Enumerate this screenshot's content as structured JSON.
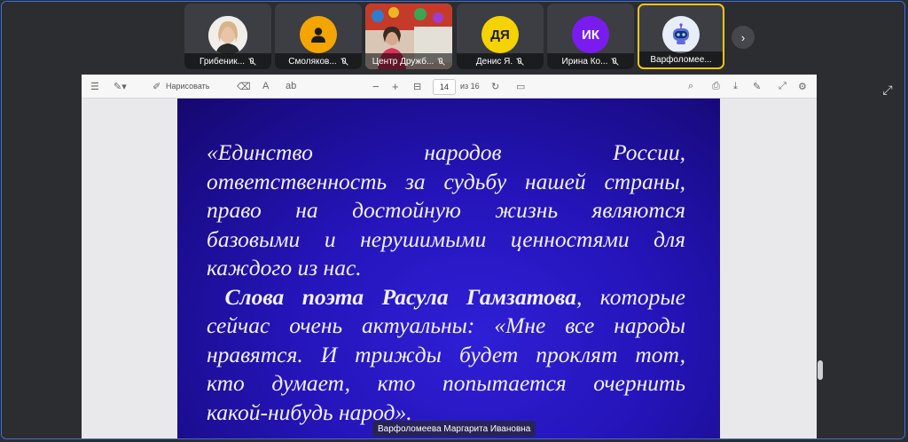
{
  "participants": [
    {
      "name": "Грибеник...",
      "type": "photo",
      "avatar_color": "#e7e2dc"
    },
    {
      "name": "Смоляков...",
      "type": "icon",
      "avatar_color": "#f5a500",
      "icon": "person-icon"
    },
    {
      "name": "Центр Дружб...",
      "type": "photo",
      "avatar_color": "#c7623e"
    },
    {
      "name": "Денис Я.",
      "type": "initials",
      "initials": "ДЯ",
      "avatar_color": "#f5d300"
    },
    {
      "name": "Ирина Ко...",
      "type": "initials",
      "initials": "ИК",
      "avatar_color": "#7a1cf0"
    },
    {
      "name": "Варфоломее...",
      "type": "bot",
      "avatar_color": "#e8eef8",
      "active": true
    }
  ],
  "toolbar": {
    "draw_label": "Нарисовать",
    "zoom_minus": "−",
    "zoom_plus": "+",
    "page_current": "14",
    "page_total": "из 16"
  },
  "slide": {
    "line1": "«Единство народов России,",
    "line2": "ответственность за судьбу нашей страны,",
    "line3": "право на достойную жизнь являются",
    "line4": "базовыми и нерушимыми ценностями для",
    "line5": "каждого из нас.",
    "line6_bold": "Слова поэта Расула Гамзатова",
    "line6_rest": ", которые",
    "line7": "сейчас очень актуальны: «Мне все народы",
    "line8": "нравятся. И трижды будет проклят тот,",
    "line9": "кто думает, кто попытается очернить",
    "line10": "какой-нибудь народ»."
  },
  "speaker_name": "Варфоломеева Маргарита Ивановна",
  "colors": {
    "active_border": "#f5c518",
    "slide_bg": "#2414b8",
    "frame": "#3d6fd6"
  }
}
